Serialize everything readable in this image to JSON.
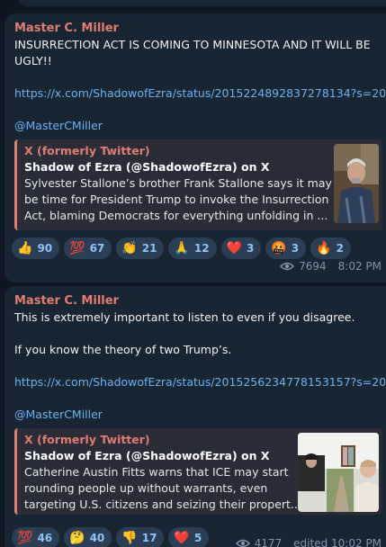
{
  "messages": [
    {
      "sender": "Master C. Miller",
      "text_lines": [
        "INSURRECTION ACT IS COMING TO MINNESOTA AND IT WILL BE",
        "UGLY!!"
      ],
      "link": "https://x.com/ShadowofEzra/status/2015224892837278134?s=20",
      "mention": "@MasterCMiller",
      "preview": {
        "site": "X (formerly Twitter)",
        "title": "Shadow of Ezra (@ShadowofEzra) on X",
        "desc_lines": [
          "Sylvester Stallone’s brother Frank Stallone says it may",
          "be time for President Trump to invoke the Insurrection",
          "Act, blaming Democrats for everything unfolding in ..."
        ]
      },
      "reactions": [
        {
          "emoji": "👍",
          "count": "90"
        },
        {
          "emoji": "💯",
          "count": "67"
        },
        {
          "emoji": "👏",
          "count": "21"
        },
        {
          "emoji": "🙏",
          "count": "12"
        },
        {
          "emoji": "❤️",
          "count": "3"
        },
        {
          "emoji": "🤬",
          "count": "3"
        },
        {
          "emoji": "🔥",
          "count": "2"
        }
      ],
      "views": "7694",
      "time": "8:02 PM"
    },
    {
      "sender": "Master C. Miller",
      "text_lines": [
        "This is extremely important to listen to even if you disagree.",
        "",
        "If you know the theory of two Trump’s."
      ],
      "link": "https://x.com/ShadowofEzra/status/2015256234778153157?s=20",
      "mention": "@MasterCMiller",
      "preview": {
        "site": "X (formerly Twitter)",
        "title": "Shadow of Ezra (@ShadowofEzra) on X",
        "desc_lines": [
          "Catherine Austin Fitts warns that ICE may start",
          "rounding people up without warrants, even",
          "targeting U.S. citizens and seizing their propert..."
        ]
      },
      "reactions": [
        {
          "emoji": "💯",
          "count": "46"
        },
        {
          "emoji": "🤔",
          "count": "40"
        },
        {
          "emoji": "👎",
          "count": "17"
        },
        {
          "emoji": "❤️",
          "count": "5"
        }
      ],
      "views": "4177",
      "time": "edited 10:02 PM"
    }
  ],
  "colors": {
    "background": "#0e1621",
    "bubble": "#182533",
    "sender": "#e27d6f",
    "link": "#6ab3f3",
    "reaction_bg": "#2a3e55",
    "meta": "#8394a6"
  },
  "icons": [
    "eye-icon"
  ]
}
